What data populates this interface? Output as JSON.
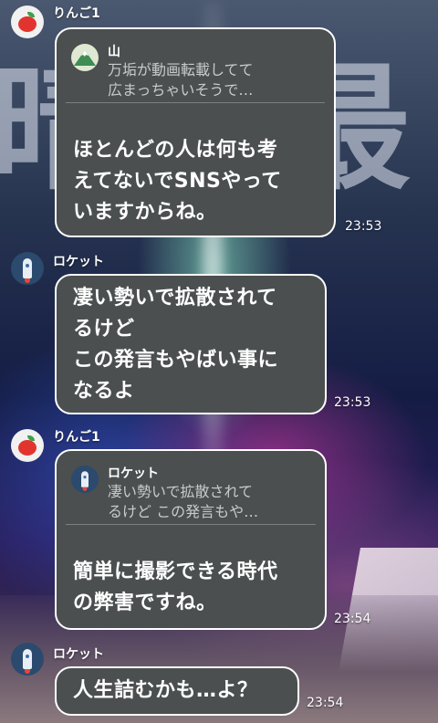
{
  "messages": [
    {
      "sender": "りんご1",
      "avatar_icon": "apple-icon",
      "reply_to": {
        "name": "山",
        "icon": "mountain-icon",
        "text": "万垢が動画転載してて\n広まっちゃいそうで…"
      },
      "text": "ほとんどの人は何も考\nえてないでSNSやって\nいますからね。",
      "time": "23:53"
    },
    {
      "sender": "ロケット",
      "avatar_icon": "rocket-icon",
      "text": "凄い勢いで拡散されて\nるけど\nこの発言もやばい事に\nなるよ",
      "time": "23:53"
    },
    {
      "sender": "りんご1",
      "avatar_icon": "apple-icon",
      "reply_to": {
        "name": "ロケット",
        "icon": "rocket-icon",
        "text": "凄い勢いで拡散されて\nるけど この発言もや…"
      },
      "text": "簡単に撮影できる時代\nの弊害ですね。",
      "time": "23:54"
    },
    {
      "sender": "ロケット",
      "avatar_icon": "rocket-icon",
      "text": "人生詰むかも…よ？",
      "time": "23:54"
    }
  ],
  "colors": {
    "bubble": "#4b4f4f",
    "bubble_border": "#ffffff",
    "text": "#ffffff",
    "quote_text": "#c8cbcb"
  }
}
